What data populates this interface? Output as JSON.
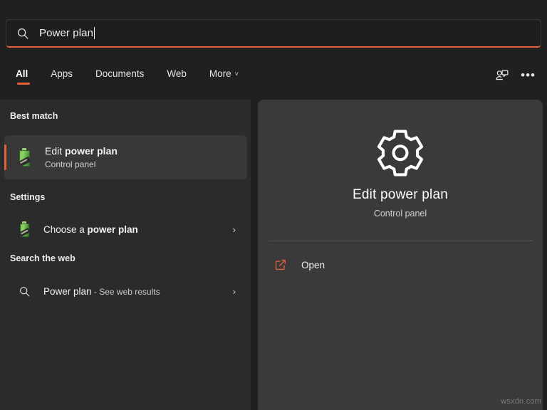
{
  "search": {
    "value": "Power plan",
    "icon": "search-icon"
  },
  "tabs": [
    {
      "label": "All",
      "active": true
    },
    {
      "label": "Apps",
      "active": false
    },
    {
      "label": "Documents",
      "active": false
    },
    {
      "label": "Web",
      "active": false
    },
    {
      "label": "More",
      "active": false,
      "chevron": "˅"
    }
  ],
  "header_actions": {
    "feedback_icon": "feedback-person-icon",
    "more_options": "•••"
  },
  "sections": {
    "best_match": "Best match",
    "settings": "Settings",
    "search_the_web": "Search the web"
  },
  "results": {
    "best": {
      "title_plain": "Edit ",
      "title_bold": "power plan",
      "subtitle": "Control panel",
      "icon": "battery-power-icon",
      "selected": true
    },
    "settings": {
      "title_plain": "Choose a ",
      "title_bold": "power plan",
      "icon": "battery-power-icon",
      "chevron": "›"
    },
    "web": {
      "title": "Power plan",
      "suffix": " - See web results",
      "icon": "search-icon",
      "chevron": "›"
    }
  },
  "detail": {
    "icon": "gear-settings-icon",
    "title": "Edit power plan",
    "subtitle": "Control panel",
    "action_label": "Open",
    "action_icon": "open-external-icon"
  },
  "watermark": "wsxdn.com",
  "colors": {
    "accent_orange": "#e2613a",
    "left_panel": "#2b2b2b",
    "right_panel": "#3a3a3a",
    "window_bg": "#202020",
    "selected_row": "#383838"
  }
}
